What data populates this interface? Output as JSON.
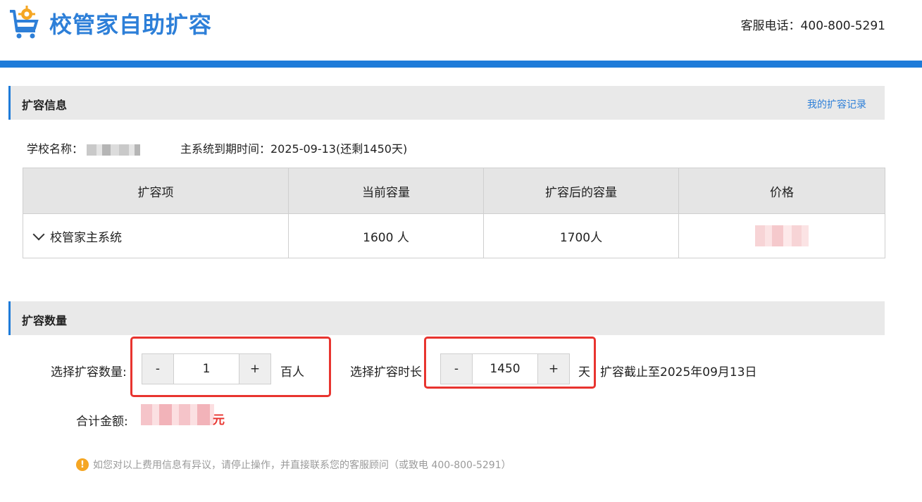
{
  "header": {
    "logo_icon": "cart-gear-icon",
    "title": "校管家自助扩容",
    "hotline": "客服电话：400-800-5291"
  },
  "colors": {
    "brand": "#1e7bd9",
    "highlight_box": "#e8342f",
    "warning": "#f5a623"
  },
  "info_section": {
    "title": "扩容信息",
    "history_link": "我的扩容记录",
    "school_label": "学校名称：",
    "expiry_text": "主系统到期时间：2025-09-13(还剩1450天)"
  },
  "table": {
    "headers": [
      "扩容项",
      "当前容量",
      "扩容后的容量",
      "价格"
    ],
    "rows": [
      {
        "item": "校管家主系统",
        "current": "1600 人",
        "after": "1700人",
        "price": ""
      }
    ]
  },
  "quantity_section": {
    "title": "扩容数量",
    "qty_label": "选择扩容数量:",
    "qty_minus": "-",
    "qty_value": "1",
    "qty_plus": "+",
    "qty_unit": "百人",
    "duration_label": "选择扩容时长",
    "dur_minus": "-",
    "dur_value": "1450",
    "dur_plus": "+",
    "dur_unit": "天",
    "deadline_text": "扩容截止至2025年09月13日",
    "total_label": "合计金额:",
    "total_unit": "元"
  },
  "notice": {
    "icon": "warning-icon",
    "text": "如您对以上费用信息有异议，请停止操作，并直接联系您的客服顾问（或致电 400-800-5291）"
  }
}
